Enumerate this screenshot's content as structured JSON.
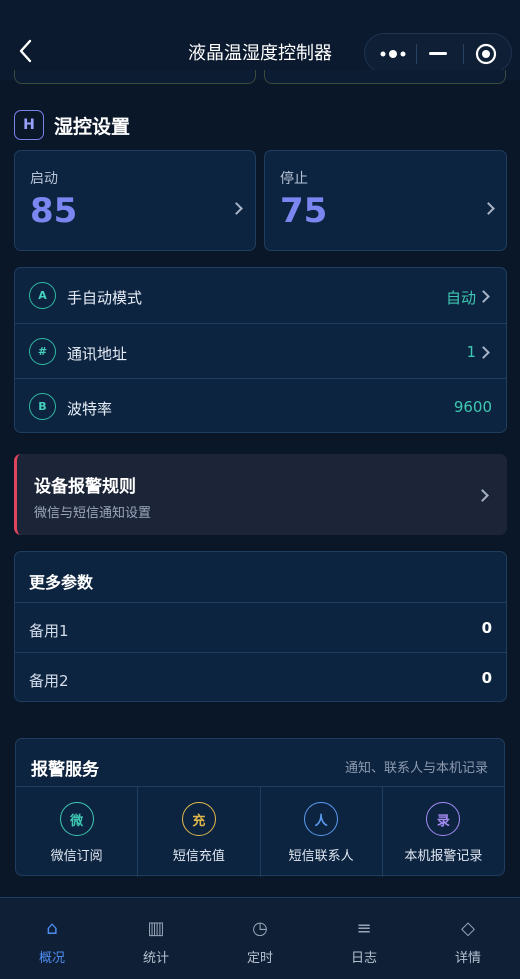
{
  "header": {
    "title": "液晶温湿度控制器"
  },
  "section": {
    "badge": "H",
    "title": "湿控设置"
  },
  "stats": [
    {
      "label": "启动",
      "value": "85"
    },
    {
      "label": "停止",
      "value": "75"
    }
  ],
  "settings": [
    {
      "icon": "A",
      "label": "手自动模式",
      "value": "自动"
    },
    {
      "icon": "#",
      "label": "通讯地址",
      "value": "1"
    },
    {
      "icon": "B",
      "label": "波特率",
      "value": "9600"
    }
  ],
  "alarm_rule": {
    "title": "设备报警规则",
    "subtitle": "微信与短信通知设置"
  },
  "more_params": {
    "title": "更多参数",
    "rows": [
      {
        "label": "备用1",
        "value": "0"
      },
      {
        "label": "备用2",
        "value": "0"
      }
    ]
  },
  "service": {
    "title": "报警服务",
    "subtitle": "通知、联系人与本机记录",
    "items": [
      {
        "icon": "微",
        "label": "微信订阅",
        "color": "#3ec8b2"
      },
      {
        "icon": "充",
        "label": "短信充值",
        "color": "#e0b84a"
      },
      {
        "icon": "人",
        "label": "短信联系人",
        "color": "#5a9cf0"
      },
      {
        "icon": "录",
        "label": "本机报警记录",
        "color": "#a58cf5"
      }
    ]
  },
  "tabs": [
    {
      "icon": "⌂",
      "label": "概况",
      "active": true
    },
    {
      "icon": "▥",
      "label": "统计",
      "active": false
    },
    {
      "icon": "◷",
      "label": "定时",
      "active": false
    },
    {
      "icon": "≡",
      "label": "日志",
      "active": false
    },
    {
      "icon": "◇",
      "label": "详情",
      "active": false
    }
  ],
  "colors": {
    "accent": "#7b86f0",
    "teal": "#3ec8b2",
    "alarm": "#e0455c",
    "active_tab": "#4f8cf0"
  }
}
